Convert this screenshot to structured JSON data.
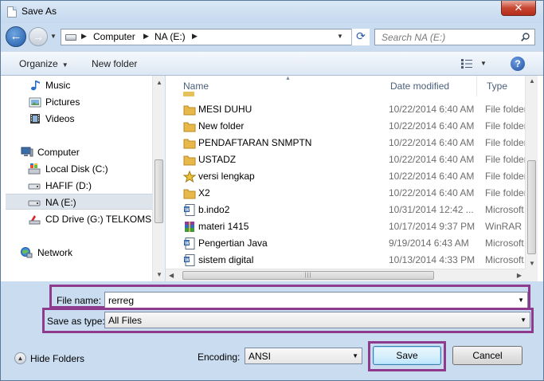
{
  "window": {
    "title": "Save As",
    "close_label": "✕"
  },
  "navigation": {
    "back_glyph": "←",
    "forward_glyph": "→",
    "breadcrumb": [
      "Computer",
      "NA (E:)"
    ],
    "refresh_glyph": "⟳",
    "search_placeholder": "Search NA (E:)"
  },
  "toolbar": {
    "organize_label": "Organize",
    "new_folder_label": "New folder",
    "help_label": "?"
  },
  "nav_pane": {
    "items": [
      {
        "label": "Music",
        "icon": "music-icon"
      },
      {
        "label": "Pictures",
        "icon": "pictures-icon"
      },
      {
        "label": "Videos",
        "icon": "videos-icon"
      },
      {
        "label": "Computer",
        "icon": "computer-icon"
      },
      {
        "label": "Local Disk (C:)",
        "icon": "local-disk-icon"
      },
      {
        "label": "HAFIF (D:)",
        "icon": "drive-icon"
      },
      {
        "label": "NA (E:)",
        "icon": "drive-icon",
        "selected": true
      },
      {
        "label": "CD Drive (G:) TELKOMSEL",
        "icon": "cd-drive-icon"
      },
      {
        "label": "Network",
        "icon": "network-icon"
      }
    ]
  },
  "file_list": {
    "columns": {
      "name": "Name",
      "date": "Date modified",
      "type": "Type"
    },
    "rows": [
      {
        "name": "MESI DUHU",
        "date": "10/22/2014 6:40 AM",
        "type": "File folder",
        "icon": "folder-icon"
      },
      {
        "name": "New folder",
        "date": "10/22/2014 6:40 AM",
        "type": "File folder",
        "icon": "folder-icon"
      },
      {
        "name": "PENDAFTARAN SNMPTN",
        "date": "10/22/2014 6:40 AM",
        "type": "File folder",
        "icon": "folder-icon"
      },
      {
        "name": "USTADZ",
        "date": "10/22/2014 6:40 AM",
        "type": "File folder",
        "icon": "folder-icon"
      },
      {
        "name": "versi lengkap",
        "date": "10/22/2014 6:40 AM",
        "type": "File folder",
        "icon": "star-folder-icon"
      },
      {
        "name": "X2",
        "date": "10/22/2014 6:40 AM",
        "type": "File folder",
        "icon": "folder-icon"
      },
      {
        "name": "b.indo2",
        "date": "10/31/2014 12:42 ...",
        "type": "Microsoft",
        "icon": "word-doc-icon"
      },
      {
        "name": "materi 1415",
        "date": "10/17/2014 9:37 PM",
        "type": "WinRAR",
        "icon": "winrar-icon"
      },
      {
        "name": "Pengertian Java",
        "date": "9/19/2014 6:43 AM",
        "type": "Microsoft",
        "icon": "word-doc-icon"
      },
      {
        "name": "sistem digital",
        "date": "10/13/2014 4:33 PM",
        "type": "Microsoft",
        "icon": "word-doc-icon"
      }
    ]
  },
  "form": {
    "file_name_label": "File name:",
    "file_name_value": "rerreg",
    "save_type_label": "Save as type:",
    "save_type_value": "All Files",
    "encoding_label": "Encoding:",
    "encoding_value": "ANSI",
    "hide_folders_label": "Hide Folders",
    "save_label": "Save",
    "cancel_label": "Cancel",
    "highlight_color": "#8e3b8e"
  }
}
